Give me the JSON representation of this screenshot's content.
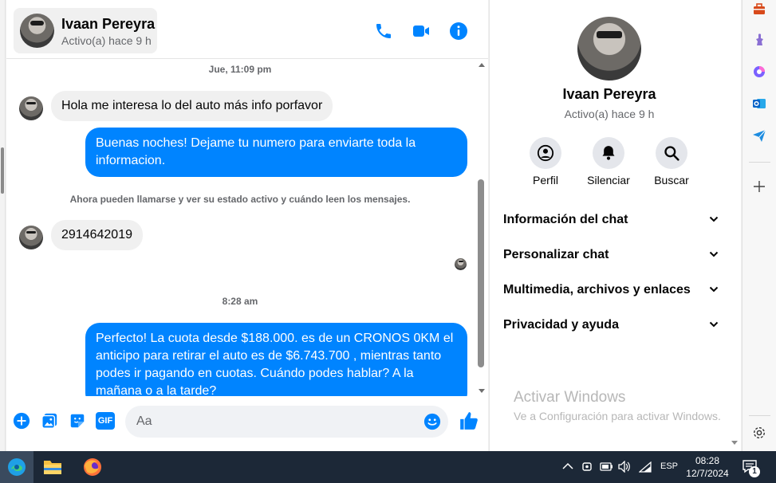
{
  "header": {
    "name": "Ivaan Pereyra",
    "status": "Activo(a) hace 9 h",
    "accent": "#0084ff"
  },
  "messages": {
    "time1": "Jue, 11:09 pm",
    "in1": "Hola me interesa lo del auto más info porfavor",
    "out1": "Buenas noches! Dejame tu numero para enviarte toda la informacion.",
    "info": "Ahora pueden llamarse y ver su estado activo y cuándo leen los mensajes.",
    "in2": "2914642019",
    "time2": "8:28 am",
    "out2": "Perfecto! La cuota desde $188.000. es de un CRONOS 0KM el anticipo para retirar el auto es de $6.743.700 , mientras tanto podes ir pagando en cuotas. Cuándo podes hablar? A la mañana o a la tarde?"
  },
  "composer": {
    "placeholder": "Aa",
    "gif_label": "GIF"
  },
  "profile": {
    "name": "Ivaan Pereyra",
    "status": "Activo(a) hace 9 h",
    "buttons": [
      {
        "label": "Perfil",
        "icon": "person-icon"
      },
      {
        "label": "Silenciar",
        "icon": "bell-icon"
      },
      {
        "label": "Buscar",
        "icon": "search-icon"
      }
    ],
    "sections": [
      "Información del chat",
      "Personalizar chat",
      "Multimedia, archivos y enlaces",
      "Privacidad y ayuda"
    ],
    "watermark_title": "Activar Windows",
    "watermark_sub": "Ve a Configuración para activar Windows."
  },
  "taskbar": {
    "language": "ESP",
    "time": "08:28",
    "date": "12/7/2024",
    "notifications": "1"
  }
}
